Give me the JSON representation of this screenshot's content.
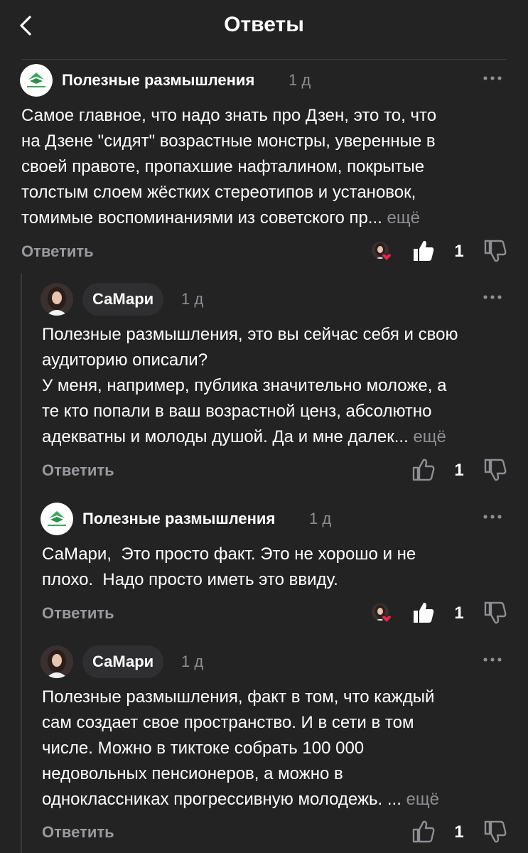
{
  "header": {
    "title": "Ответы"
  },
  "colors": {
    "background": "#232324",
    "text": "#ffffff",
    "muted": "#8e8e93",
    "liked_heart": "#e8234c"
  },
  "comments": [
    {
      "author": "Полезные размышления",
      "time": "1 д",
      "text": "Самое главное, что надо знать про Дзен, это то, что\nна Дзене \"сидят\" возрастные монстры, уверенные в\nсвоей правоте, пропахшие нафталином, покрытые\nтолстым слоем жёстких стереотипов и установок,\nтомимые воспоминаниями из советского пр... ",
      "more": "ещё",
      "reply": "Ответить",
      "likes": "1"
    },
    {
      "author": "СаМари",
      "time": "1 д",
      "text": "Полезные размышления, это вы сейчас себя и свою\nаудиторию описали?\nУ меня, например, публика значительно моложе, а\nте кто попали в ваш возрастной ценз, абсолютно\nадекватны и молоды душой. Да и мне далек... ",
      "more": "ещё",
      "reply": "Ответить",
      "likes": "1"
    },
    {
      "author": "Полезные размышления",
      "time": "1 д",
      "text": "СаМари,  Это просто факт. Это не хорошо и не\nплохо.  Надо просто иметь это ввиду.",
      "reply": "Ответить",
      "likes": "1"
    },
    {
      "author": "СаМари",
      "time": "1 д",
      "text": "Полезные размышления, факт в том, что каждый\nсам создает свое пространство. И в сети в том\nчисле. Можно в тиктоке собрать 100 000\nнедовольных пенсионеров, а можно в\nодноклассниках прогрессивную молодежь. ... ",
      "more": "ещё",
      "reply": "Ответить",
      "likes": "1"
    }
  ]
}
